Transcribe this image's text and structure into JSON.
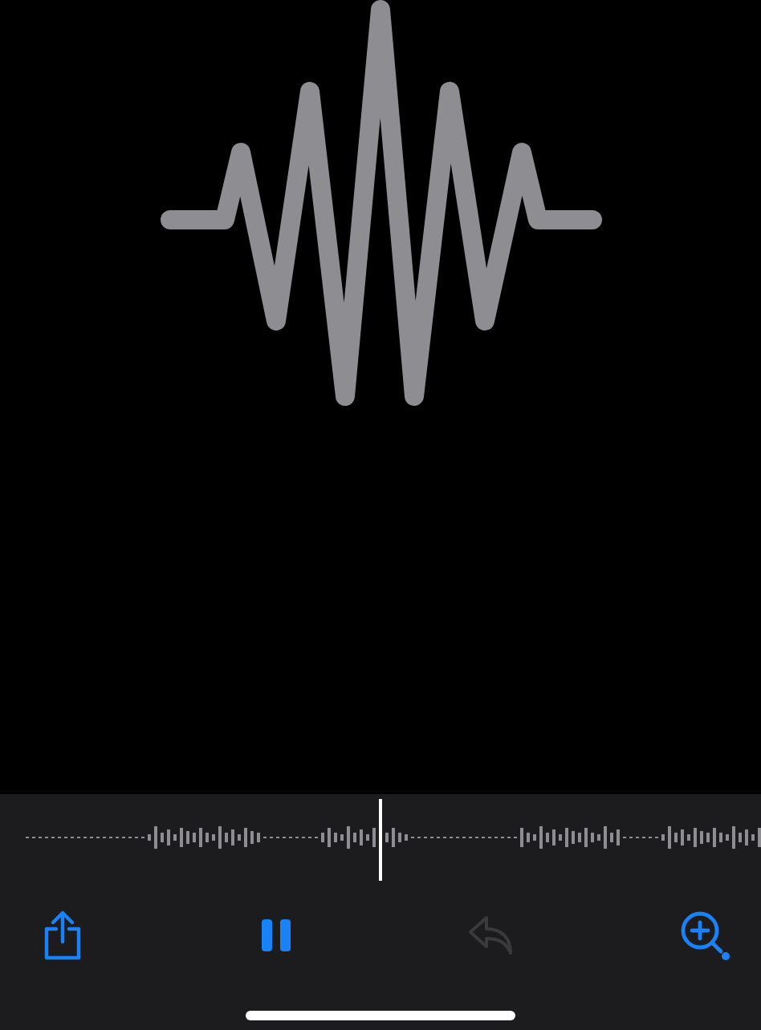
{
  "toolbar": [
    {
      "kind": "share",
      "disabled": false
    },
    {
      "kind": "pause",
      "disabled": false
    },
    {
      "kind": "undo",
      "disabled": true
    },
    {
      "kind": "zoom",
      "disabled": false
    }
  ]
}
